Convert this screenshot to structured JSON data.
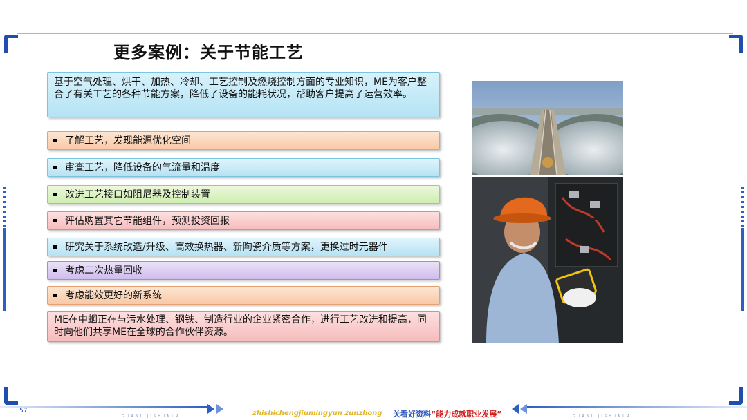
{
  "slide": {
    "title": "更多案例：关于节能工艺",
    "intro": "基于空气处理、烘干、加热、冷却、工艺控制及燃烧控制方面的专业知识，ME为客户整合了有关工艺的各种节能方案，降低了设备的能耗状况，帮助客户提高了运营效率。",
    "items": [
      {
        "text": "了解工艺，发现能源优化空间",
        "color": "orange"
      },
      {
        "text": "审查工艺，降低设备的气流量和温度",
        "color": "blue"
      },
      {
        "text": "改进工艺接口如阻尼器及控制装置",
        "color": "green"
      },
      {
        "text": "评估购置其它节能组件，预测投资回报",
        "color": "red"
      },
      {
        "text": "研究关于系统改造/升级、高效换热器、新陶瓷介质等方案，更换过时元器件",
        "color": "blue"
      },
      {
        "text": "考虑二次热量回收",
        "color": "purple"
      },
      {
        "text": "考虑能效更好的新系统",
        "color": "orange"
      }
    ],
    "outro": "ME在中蛔正在与污水处理、钢铁、制造行业的企业紧密合作，进行工艺改进和提高，同时向他们共享ME在全球的合作伙伴资源。"
  },
  "images": {
    "top": "water-treatment-plant-photo",
    "bottom": "engineer-hardhat-control-panel-photo"
  },
  "footer": {
    "page_number": "57",
    "pinyin": "zhishichengjiumingyun zunzhong",
    "slogan_prefix": "关看好资料",
    "slogan_quote": "“能力成就职业发展”",
    "small_left": "GUANLIJISHUNUA",
    "small_right": "GUANLIJISHUNUA"
  },
  "colors": {
    "accent_blue": "#1f4fae",
    "title": "#111111",
    "footer_pinyin": "#e1b62c",
    "footer_quote": "#d01c1c"
  }
}
